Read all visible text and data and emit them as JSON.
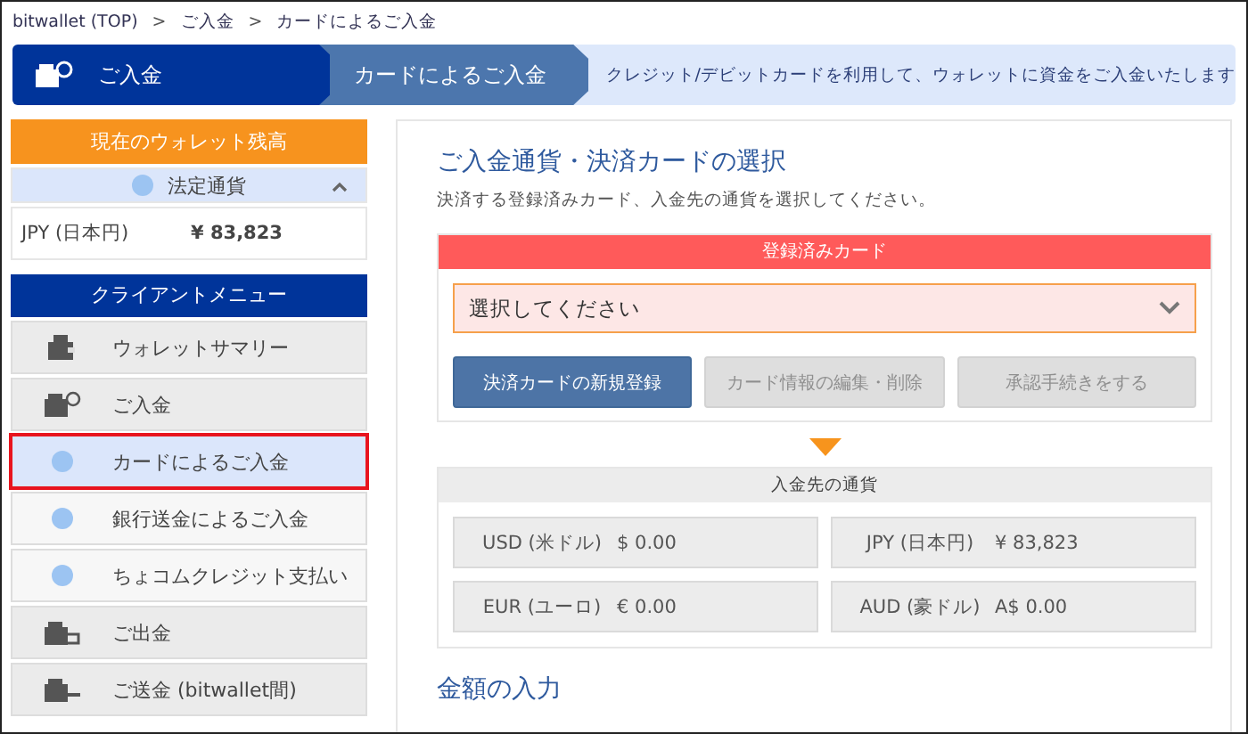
{
  "breadcrumb": [
    "bitwallet (TOP)",
    "ご入金",
    "カードによるご入金"
  ],
  "breadcrumb_separator": ">",
  "steps": [
    {
      "label": "ご入金",
      "kind": "first"
    },
    {
      "label": "カードによるご入金",
      "kind": "middle"
    },
    {
      "label": "クレジット/デビットカードを利用して、ウォレットに資金をご入金いたします",
      "kind": "last"
    }
  ],
  "wallet": {
    "title": "現在のウォレット残高",
    "section": {
      "label": "法定通貨",
      "expanded": true
    },
    "balances": [
      {
        "currency": "JPY (日本円)",
        "amount": "¥ 83,823"
      }
    ]
  },
  "menu": {
    "title": "クライアントメニュー",
    "items": [
      {
        "label": "ウォレットサマリー",
        "kind": "main",
        "selected": false
      },
      {
        "label": "ご入金",
        "kind": "main",
        "selected": false
      },
      {
        "label": "カードによるご入金",
        "kind": "sub",
        "selected": true
      },
      {
        "label": "銀行送金によるご入金",
        "kind": "sub",
        "selected": false
      },
      {
        "label": "ちょコムクレジット支払い",
        "kind": "sub",
        "selected": false
      },
      {
        "label": "ご出金",
        "kind": "main",
        "selected": false
      },
      {
        "label": "ご送金 (bitwallet間)",
        "kind": "main",
        "selected": false
      }
    ]
  },
  "selection": {
    "title": "ご入金通貨・決済カードの選択",
    "description": "決済する登録済みカード、入金先の通貨を選択してください。",
    "card_header": "登録済みカード",
    "card_select": {
      "value": "選択してください"
    },
    "buttons": [
      {
        "label": "決済カードの新規登録",
        "disabled": false
      },
      {
        "label": "カード情報の編集・削除",
        "disabled": true
      },
      {
        "label": "承認手続きをする",
        "disabled": true
      }
    ]
  },
  "destination": {
    "title": "入金先の通貨",
    "currencies": [
      {
        "name": "USD (米ドル)",
        "amount": "$ 0.00"
      },
      {
        "name": "JPY (日本円)",
        "amount": "¥ 83,823"
      },
      {
        "name": "EUR (ユーロ)",
        "amount": "€ 0.00"
      },
      {
        "name": "AUD (豪ドル)",
        "amount": "A$ 0.00"
      }
    ]
  },
  "amount_section": {
    "title": "金額の入力"
  }
}
